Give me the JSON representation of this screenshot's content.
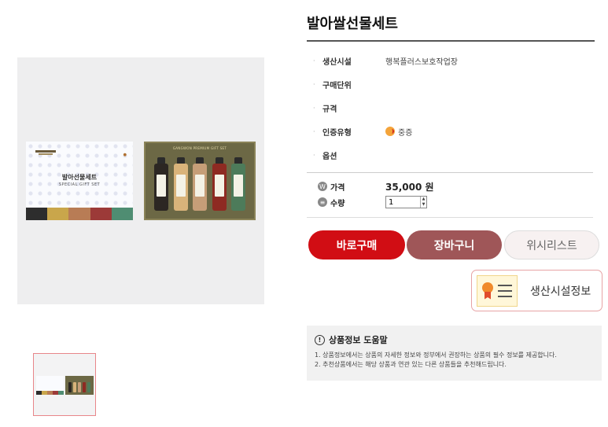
{
  "product": {
    "title": "발아쌀선물세트",
    "image_alt": "발아쌀선물세트 상품 이미지"
  },
  "box_art": {
    "lid_title": "발아선물세트",
    "lid_subtitle": "SPECIAL GIFT SET",
    "tray_label": "GANGWON PREMIUM GIFT SET",
    "stripe_colors": [
      "#2d2d2d",
      "#c9a64b",
      "#b87c55",
      "#9c3a38",
      "#4f8d72"
    ],
    "bottle_colors": [
      "#2c2723",
      "#d9b37a",
      "#c69e78",
      "#8e2a22",
      "#4d7b5a"
    ]
  },
  "specs": [
    {
      "key": "생산시설",
      "value": "행복플러스보호작업장",
      "icon": ""
    },
    {
      "key": "구매단위",
      "value": "",
      "icon": ""
    },
    {
      "key": "규격",
      "value": "",
      "icon": ""
    },
    {
      "key": "인증유형",
      "value": "중증",
      "icon": "certification-icon"
    },
    {
      "key": "옵션",
      "value": "",
      "icon": ""
    }
  ],
  "purchase": {
    "price_label": "가격",
    "price_value": "35,000 원",
    "qty_label": "수량",
    "qty_value": "1",
    "price_icon": "W",
    "qty_icon": "≡"
  },
  "buttons": {
    "buy": "바로구매",
    "cart": "장바구니",
    "wishlist": "위시리스트",
    "facility_info": "생산시설정보"
  },
  "help": {
    "icon": "!",
    "title": "상품정보 도움말",
    "lines": [
      "1. 상품정보에서는 상품의 자세한 정보와 정부에서 권장하는 상품의 필수 정보를 제공합니다.",
      "2. 추천상품에서는 해당 상품과 연관 있는 다른 상품들을 추천해드립니다."
    ]
  },
  "colors": {
    "buy": "#d10d14",
    "cart": "#9f5658",
    "wishlist": "#f7f1f1"
  }
}
